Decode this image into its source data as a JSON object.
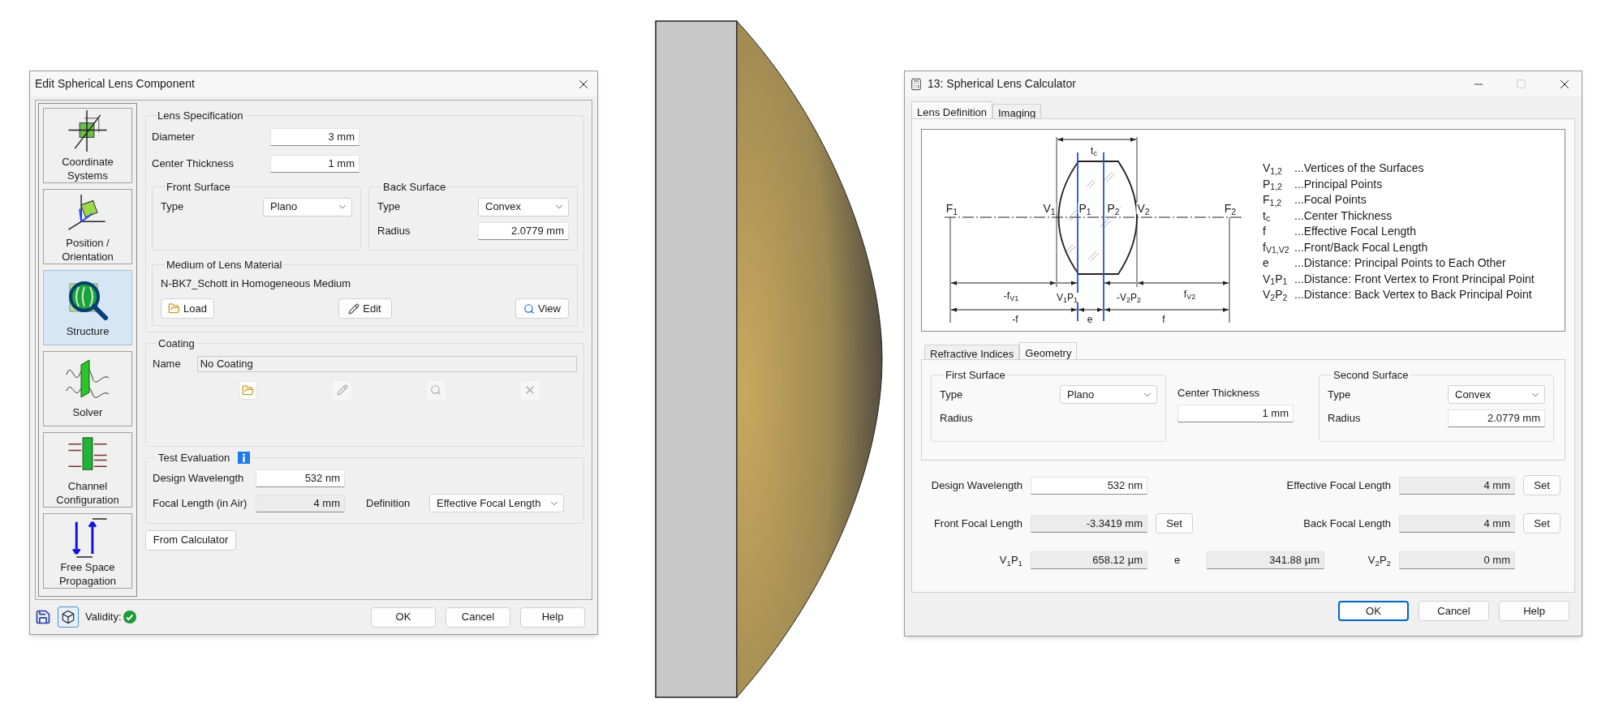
{
  "edit_dialog": {
    "title": "Edit Spherical Lens Component",
    "sidebar": [
      {
        "label": "Coordinate Systems",
        "selected": false
      },
      {
        "label": "Position / Orientation",
        "selected": false
      },
      {
        "label": "Structure",
        "selected": true
      },
      {
        "label": "Solver",
        "selected": false
      },
      {
        "label": "Channel Configuration",
        "selected": false
      },
      {
        "label": "Free Space Propagation",
        "selected": false
      }
    ],
    "lens_specification": {
      "title": "Lens Specification",
      "fields": [
        {
          "label": "Diameter",
          "value": "3 mm"
        },
        {
          "label": "Center Thickness",
          "value": "1 mm"
        }
      ]
    },
    "front_surface": {
      "title": "Front Surface",
      "type_label": "Type",
      "type_value": "Plano"
    },
    "back_surface": {
      "title": "Back Surface",
      "type_label": "Type",
      "type_value": "Convex",
      "radius_label": "Radius",
      "radius_value": "2.0779 mm"
    },
    "medium": {
      "title": "Medium of Lens Material",
      "name": "N-BK7_Schott in Homogeneous Medium",
      "buttons": [
        "Load",
        "Edit",
        "View"
      ]
    },
    "coating": {
      "title": "Coating",
      "name_label": "Name",
      "name_value": "No Coating"
    },
    "test_evaluation": {
      "title": "Test Evaluation",
      "wavelength_label": "Design Wavelength",
      "wavelength_value": "532 nm",
      "focal_label": "Focal Length (in Air)",
      "focal_value": "4 mm",
      "definition_label": "Definition",
      "definition_value": "Effective Focal Length"
    },
    "from_calculator": "From Calculator",
    "validity_label": "Validity:",
    "valid": true,
    "buttons": [
      {
        "label": "OK",
        "default": false
      },
      {
        "label": "Cancel",
        "default": false
      },
      {
        "label": "Help",
        "default": false
      }
    ]
  },
  "calculator_dialog": {
    "title": "13: Spherical Lens Calculator",
    "tabs": [
      {
        "label": "Lens Definition",
        "selected": true
      },
      {
        "label": "Imaging",
        "selected": false
      }
    ],
    "diagram_labels": [
      {
        "text": "t$_{c}$"
      },
      {
        "text": "F$_{1}$"
      },
      {
        "text": "V$_{1}$"
      },
      {
        "text": "P$_{1}$"
      },
      {
        "text": "P$_{2}$"
      },
      {
        "text": "V$_{2}$"
      },
      {
        "text": "F$_{2}$"
      },
      {
        "text": "-f$_{V1}$"
      },
      {
        "text": "V$_{1}$P$_{1}$"
      },
      {
        "text": "-V$_{2}$P$_{2}$"
      },
      {
        "text": "f$_{V2}$"
      },
      {
        "text": "-f"
      },
      {
        "text": "e"
      },
      {
        "text": "f"
      }
    ],
    "legend": [
      {
        "symbol": "V$_{1,2}$",
        "text": "...Vertices of the Surfaces"
      },
      {
        "symbol": "P$_{1,2}$",
        "text": "...Principal Points"
      },
      {
        "symbol": "F$_{1,2}$",
        "text": "...Focal Points"
      },
      {
        "symbol": "t$_{c}$",
        "text": "...Center Thickness"
      },
      {
        "symbol": "f",
        "text": "...Effective Focal Length"
      },
      {
        "symbol": "f$_{V1,V2}$",
        "text": "...Front/Back Focal Length"
      },
      {
        "symbol": "e",
        "text": "...Distance: Principal Points to Each Other"
      },
      {
        "symbol": "V$_{1}$P$_{1}$",
        "text": "...Distance: Front Vertex to Front Principal Point"
      },
      {
        "symbol": "V$_{2}$P$_{2}$",
        "text": "...Distance: Back Vertex to Back Principal Point"
      }
    ],
    "subtabs": [
      {
        "label": "Refractive Indices",
        "selected": false
      },
      {
        "label": "Geometry",
        "selected": true
      }
    ],
    "first_surface": {
      "title": "First Surface",
      "type_label": "Type",
      "type_value": "Plano",
      "radius_label": "Radius"
    },
    "center_thickness": {
      "label": "Center Thickness",
      "value": "1 mm"
    },
    "second_surface": {
      "title": "Second Surface",
      "type_label": "Type",
      "type_value": "Convex",
      "radius_label": "Radius",
      "radius_value": "2.0779 mm"
    },
    "design_wavelength": {
      "label": "Design Wavelength",
      "value": "532 nm",
      "editable": true
    },
    "effective_focal_length": {
      "label": "Effective Focal Length",
      "value": "4 mm",
      "editable": false,
      "button": "Set"
    },
    "front_focal_length": {
      "label": "Front Focal Length",
      "value": "-3.3419 mm",
      "editable": false,
      "button": "Set"
    },
    "back_focal_length": {
      "label": "Back Focal Length",
      "value": "4 mm",
      "editable": false,
      "button": "Set"
    },
    "v1p1": {
      "label": "V$_{1}$P$_{1}$",
      "value": "658.12 µm",
      "editable": false
    },
    "e": {
      "label": "e",
      "value": "341.88 µm",
      "editable": false
    },
    "v2p2": {
      "label": "V$_{2}$P$_{2}$",
      "value": "0 mm",
      "editable": false
    },
    "buttons": [
      {
        "label": "OK",
        "default": true
      },
      {
        "label": "Cancel",
        "default": false
      },
      {
        "label": "Help",
        "default": false
      }
    ]
  }
}
